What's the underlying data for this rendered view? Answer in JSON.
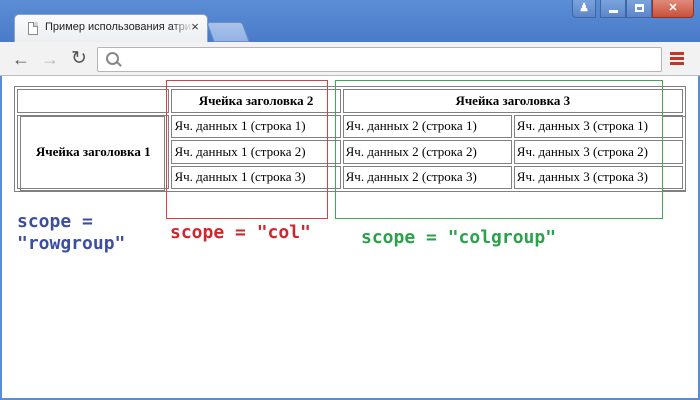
{
  "browser": {
    "tab_title": "Пример использования атрибута scope",
    "tab_close": "×",
    "url": "",
    "controls": {
      "back": "←",
      "forward": "→",
      "reload": "↻",
      "user": "♟"
    }
  },
  "table": {
    "header_row": {
      "h2": "Ячейка заголовка 2",
      "h3": "Ячейка заголовка 3"
    },
    "row_header": "Ячейка заголовка 1",
    "rows": [
      [
        "Яч. данных 1 (строка 1)",
        "Яч. данных 2 (строка 1)",
        "Яч. данных 3 (строка 1)"
      ],
      [
        "Яч. данных 1 (строка 2)",
        "Яч. данных 2 (строка 2)",
        "Яч. данных 3 (строка 2)"
      ],
      [
        "Яч. данных 1 (строка 3)",
        "Яч. данных 2 (строка 3)",
        "Яч. данных 3 (строка 3)"
      ]
    ]
  },
  "annotations": {
    "rowgroup": "scope =\n\"rowgroup\"",
    "col": "scope = \"col\"",
    "colgroup": "scope = \"colgroup\""
  },
  "colors": {
    "rowgroup": "#3b4fa1",
    "col": "#d0262c",
    "colgroup": "#2aa24a",
    "chrome": "#4a7bc8"
  }
}
